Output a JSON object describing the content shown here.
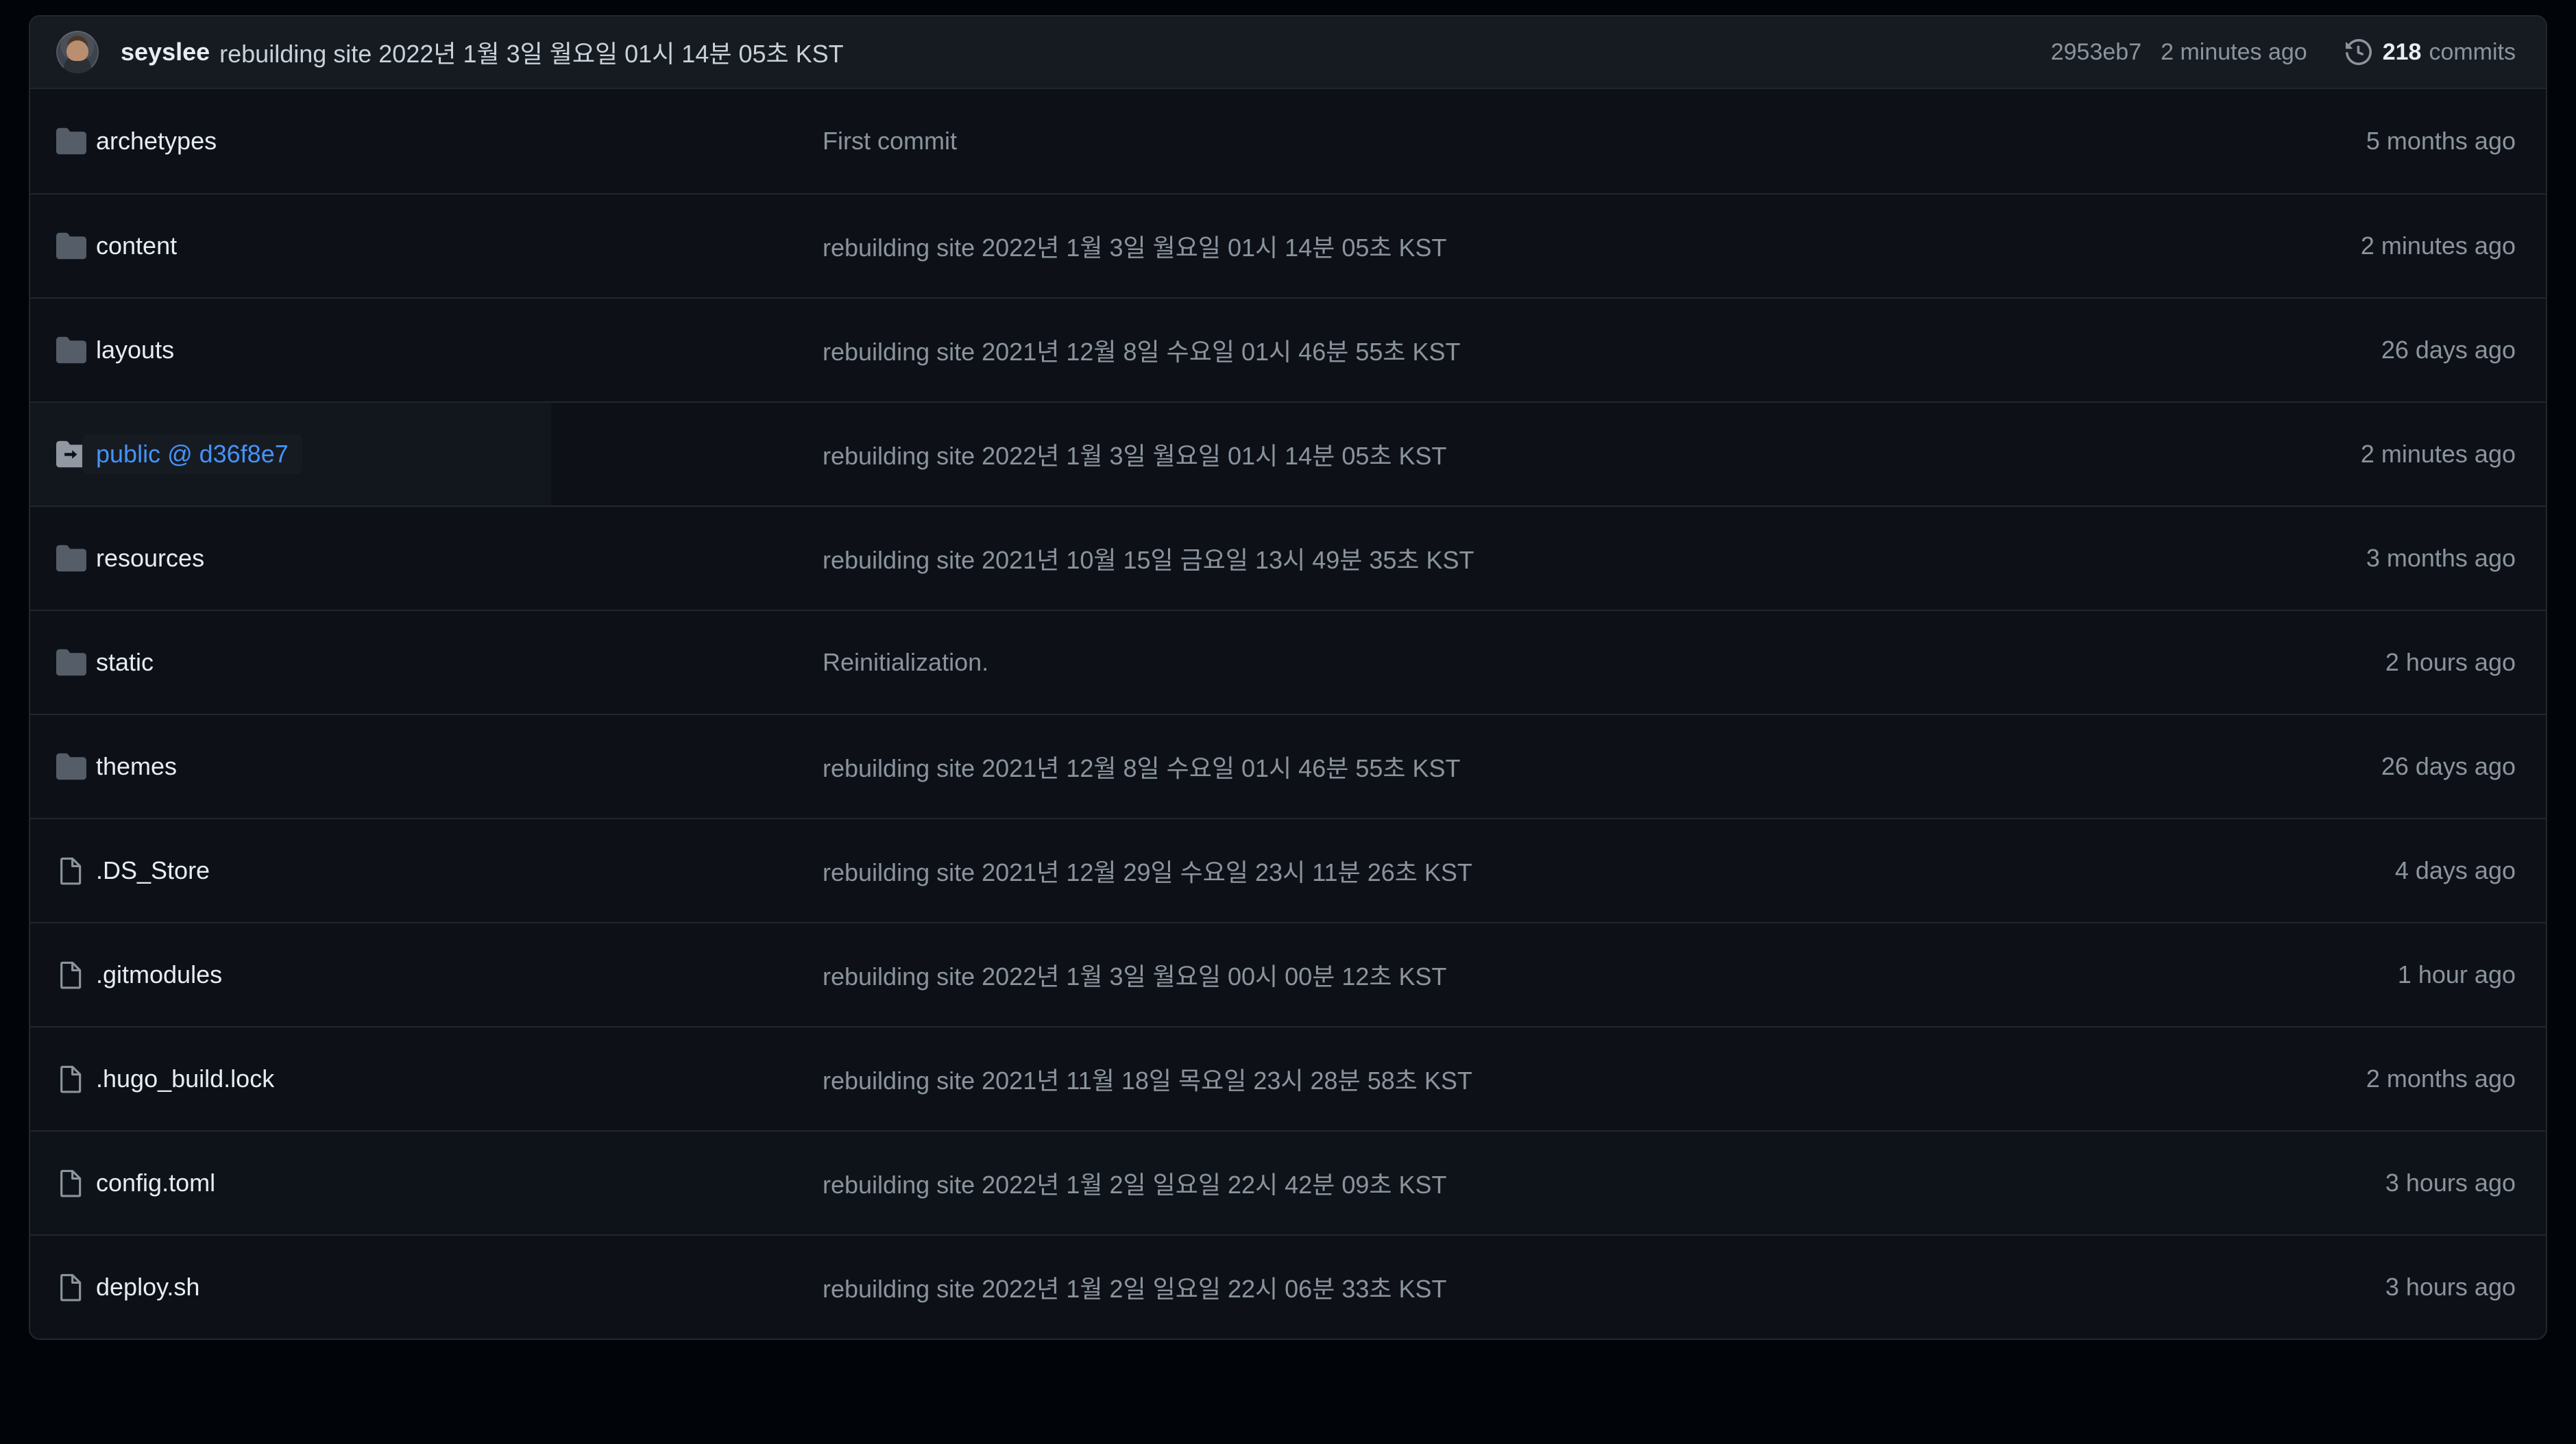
{
  "header": {
    "author": "seyslee",
    "message": "rebuilding site 2022년 1월 3일 월요일 01시 14분 05초 KST",
    "sha": "2953eb7",
    "relative_time": "2 minutes ago",
    "commit_count": "218",
    "commits_label": "commits",
    "history_icon": "history-icon",
    "avatar_icon": "avatar"
  },
  "rows": [
    {
      "name": "archetypes",
      "type": "directory",
      "icon": "folder-icon",
      "message": "First commit",
      "time": "5 months ago"
    },
    {
      "name": "content",
      "type": "directory",
      "icon": "folder-icon",
      "message": "rebuilding site 2022년 1월 3일 월요일 01시 14분 05초 KST",
      "time": "2 minutes ago"
    },
    {
      "name": "layouts",
      "type": "directory",
      "icon": "folder-icon",
      "message": "rebuilding site 2021년 12월 8일 수요일 01시 46분 55초 KST",
      "time": "26 days ago"
    },
    {
      "name": "public @ d36f8e7",
      "type": "submodule",
      "icon": "submodule-folder-icon",
      "message": "rebuilding site 2022년 1월 3일 월요일 01시 14분 05초 KST",
      "time": "2 minutes ago"
    },
    {
      "name": "resources",
      "type": "directory",
      "icon": "folder-icon",
      "message": "rebuilding site 2021년 10월 15일 금요일 13시 49분 35초 KST",
      "time": "3 months ago"
    },
    {
      "name": "static",
      "type": "directory",
      "icon": "folder-icon",
      "message": "Reinitialization.",
      "time": "2 hours ago"
    },
    {
      "name": "themes",
      "type": "directory",
      "icon": "folder-icon",
      "message": "rebuilding site 2021년 12월 8일 수요일 01시 46분 55초 KST",
      "time": "26 days ago"
    },
    {
      "name": ".DS_Store",
      "type": "file",
      "icon": "file-icon",
      "message": "rebuilding site 2021년 12월 29일 수요일 23시 11분 26초 KST",
      "time": "4 days ago"
    },
    {
      "name": ".gitmodules",
      "type": "file",
      "icon": "file-icon",
      "message": "rebuilding site 2022년 1월 3일 월요일 00시 00분 12초 KST",
      "time": "1 hour ago"
    },
    {
      "name": ".hugo_build.lock",
      "type": "file",
      "icon": "file-icon",
      "message": "rebuilding site 2021년 11월 18일 목요일 23시 28분 58초 KST",
      "time": "2 months ago"
    },
    {
      "name": "config.toml",
      "type": "file",
      "icon": "file-icon",
      "message": "rebuilding site 2022년 1월 2일 일요일 22시 42분 09초 KST",
      "time": "3 hours ago"
    },
    {
      "name": "deploy.sh",
      "type": "file",
      "icon": "file-icon",
      "message": "rebuilding site 2022년 1월 2일 일요일 22시 06분 33초 KST",
      "time": "3 hours ago"
    }
  ],
  "colors": {
    "background": "#010409",
    "surface": "#0d1117",
    "header_surface": "#161b22",
    "border": "#21262d",
    "text_primary": "#e6edf3",
    "text_muted": "#8b949e",
    "link": "#4493f8",
    "folder": "#545d68"
  }
}
